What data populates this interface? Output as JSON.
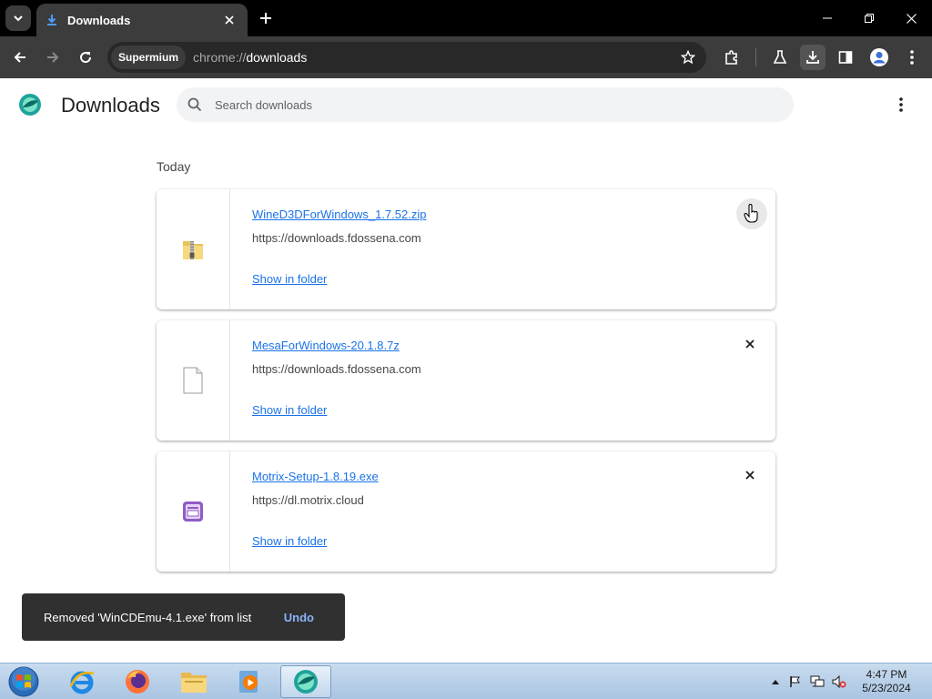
{
  "browser": {
    "tab": {
      "title": "Downloads"
    },
    "omnibox": {
      "site_chip": "Supermium",
      "url_scheme": "chrome://",
      "url_path": "downloads"
    }
  },
  "page": {
    "title": "Downloads",
    "search": {
      "placeholder": "Search downloads"
    },
    "section_label": "Today"
  },
  "downloads": [
    {
      "file_name": "WineD3DForWindows_1.7.52.zip",
      "source": "https://downloads.fdossena.com",
      "action": "Show in folder",
      "icon": "zip-folder-icon"
    },
    {
      "file_name": "MesaForWindows-20.1.8.7z",
      "source": "https://downloads.fdossena.com",
      "action": "Show in folder",
      "icon": "blank-file-icon"
    },
    {
      "file_name": "Motrix-Setup-1.8.19.exe",
      "source": "https://dl.motrix.cloud",
      "action": "Show in folder",
      "icon": "motrix-app-icon"
    }
  ],
  "toast": {
    "message": "Removed 'WinCDEmu-4.1.exe' from list",
    "action": "Undo"
  },
  "taskbar": {
    "apps": [
      "internet-explorer-icon",
      "firefox-icon",
      "file-explorer-icon",
      "media-player-icon",
      "supermium-icon"
    ],
    "clock": {
      "time": "4:47 PM",
      "date": "5/23/2024"
    }
  },
  "colors": {
    "link": "#1a73e8",
    "undo": "#8ab4f8",
    "toolbar": "#3c3c3c",
    "titlebar": "#000000",
    "supermium_teal": "#1fa39a"
  }
}
